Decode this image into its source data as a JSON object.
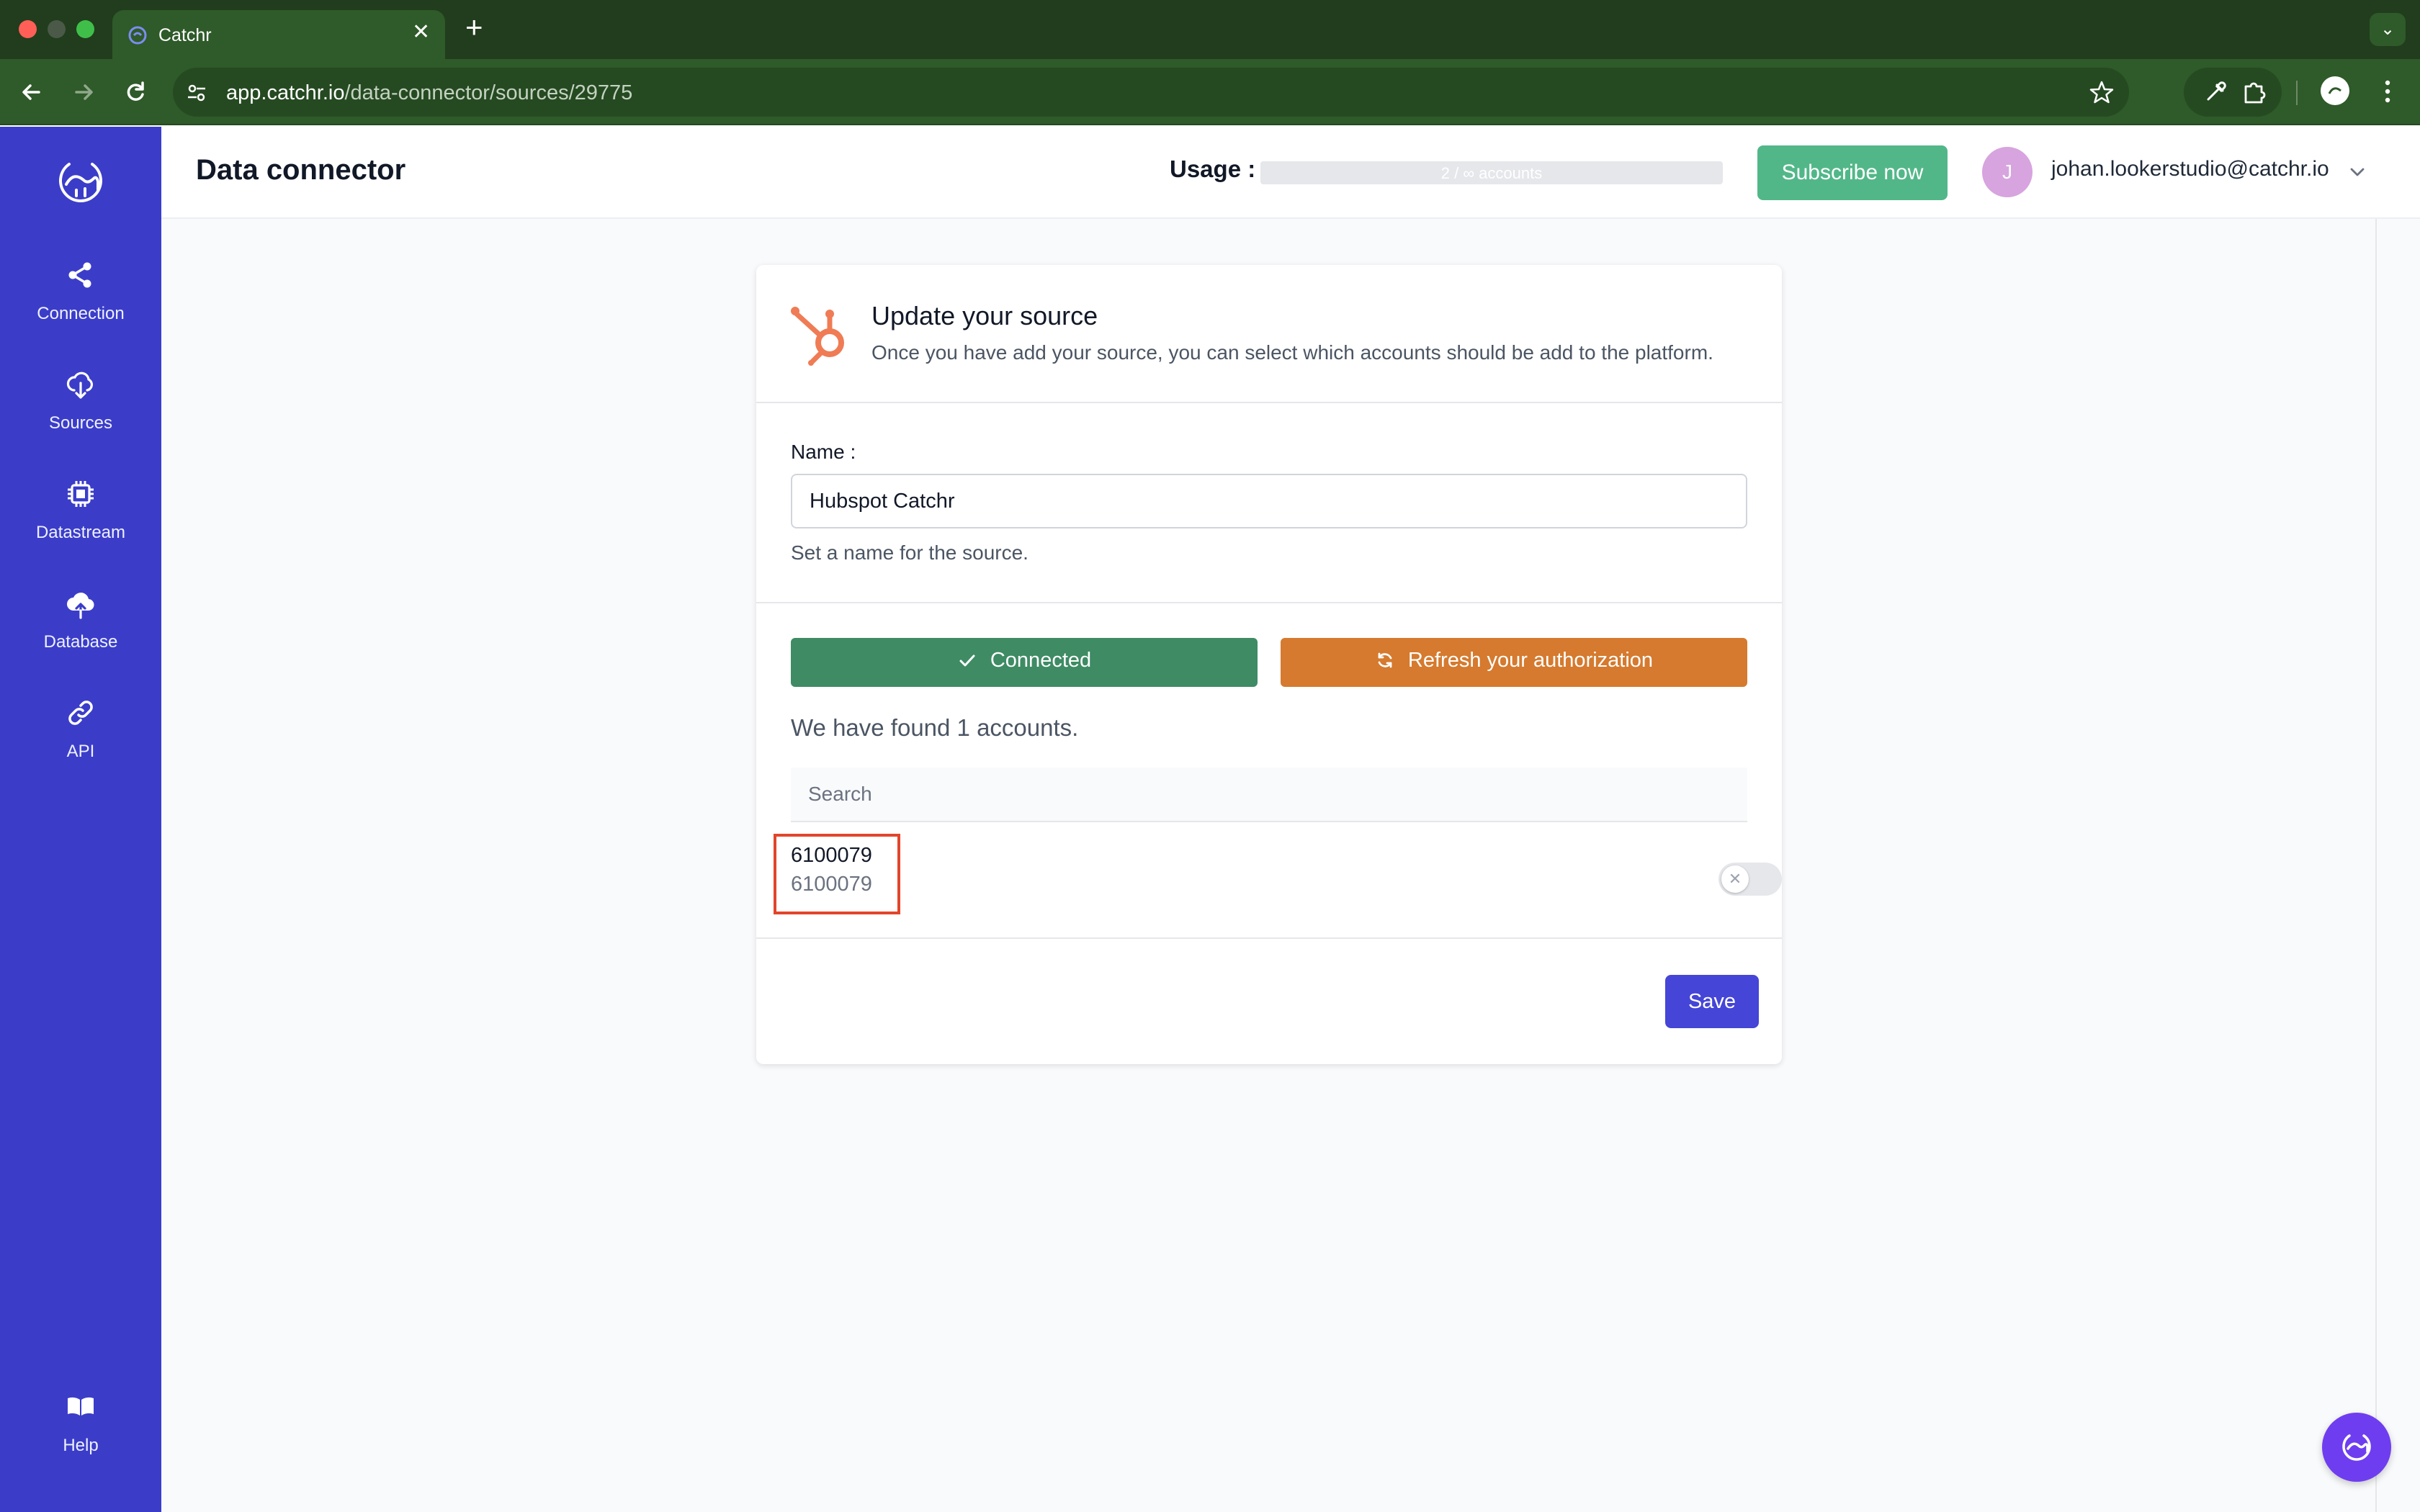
{
  "browser": {
    "tab_title": "Catchr",
    "url_host": "app.catchr.io",
    "url_path": "/data-connector/sources/29775",
    "icons": {
      "tab_favicon": "catchr-logo-icon",
      "close_tab": "close-icon",
      "new_tab": "plus-icon",
      "tab_menu": "chevron-down-icon",
      "back": "arrow-left-icon",
      "forward": "arrow-right-icon",
      "reload": "reload-icon",
      "site_info": "tune-icon",
      "bookmark": "star-icon",
      "eyedropper": "eyedropper-icon",
      "extensions": "puzzle-icon",
      "profile": "profile-icon",
      "menu": "kebab-icon"
    }
  },
  "sidebar": {
    "logo": "catchr-logo-icon",
    "items": [
      {
        "label": "Connection",
        "icon": "share-icon"
      },
      {
        "label": "Sources",
        "icon": "cloud-download-icon"
      },
      {
        "label": "Datastream",
        "icon": "chip-icon"
      },
      {
        "label": "Database",
        "icon": "cloud-upload-icon"
      },
      {
        "label": "API",
        "icon": "link-icon"
      }
    ],
    "help": {
      "label": "Help",
      "icon": "book-icon"
    }
  },
  "header": {
    "title": "Data connector",
    "usage_label": "Usage :",
    "usage_text": "2 / ∞ accounts",
    "usage_fraction": 0.0,
    "subscribe_label": "Subscribe now",
    "avatar_initial": "J",
    "user_email": "johan.lookerstudio@catchr.io"
  },
  "card": {
    "title": "Update your source",
    "subtitle": "Once you have add your source, you can select which accounts should be add to the platform.",
    "source_icon": "hubspot-icon",
    "name_label": "Name :",
    "name_value": "Hubspot Catchr",
    "name_help": "Set a name for the source.",
    "connected_label": "Connected",
    "refresh_label": "Refresh your authorization",
    "found_text": "We have found 1 accounts.",
    "search_placeholder": "Search",
    "accounts": [
      {
        "name": "6100079",
        "id": "6100079",
        "enabled": false
      }
    ],
    "save_label": "Save"
  },
  "colors": {
    "sidebar": "#3b3dc9",
    "connected": "#3e8b64",
    "refresh": "#d57a2e",
    "subscribe": "#52b788",
    "save": "#4545d8",
    "highlight": "#e2452b",
    "chat": "#6f3df0"
  }
}
